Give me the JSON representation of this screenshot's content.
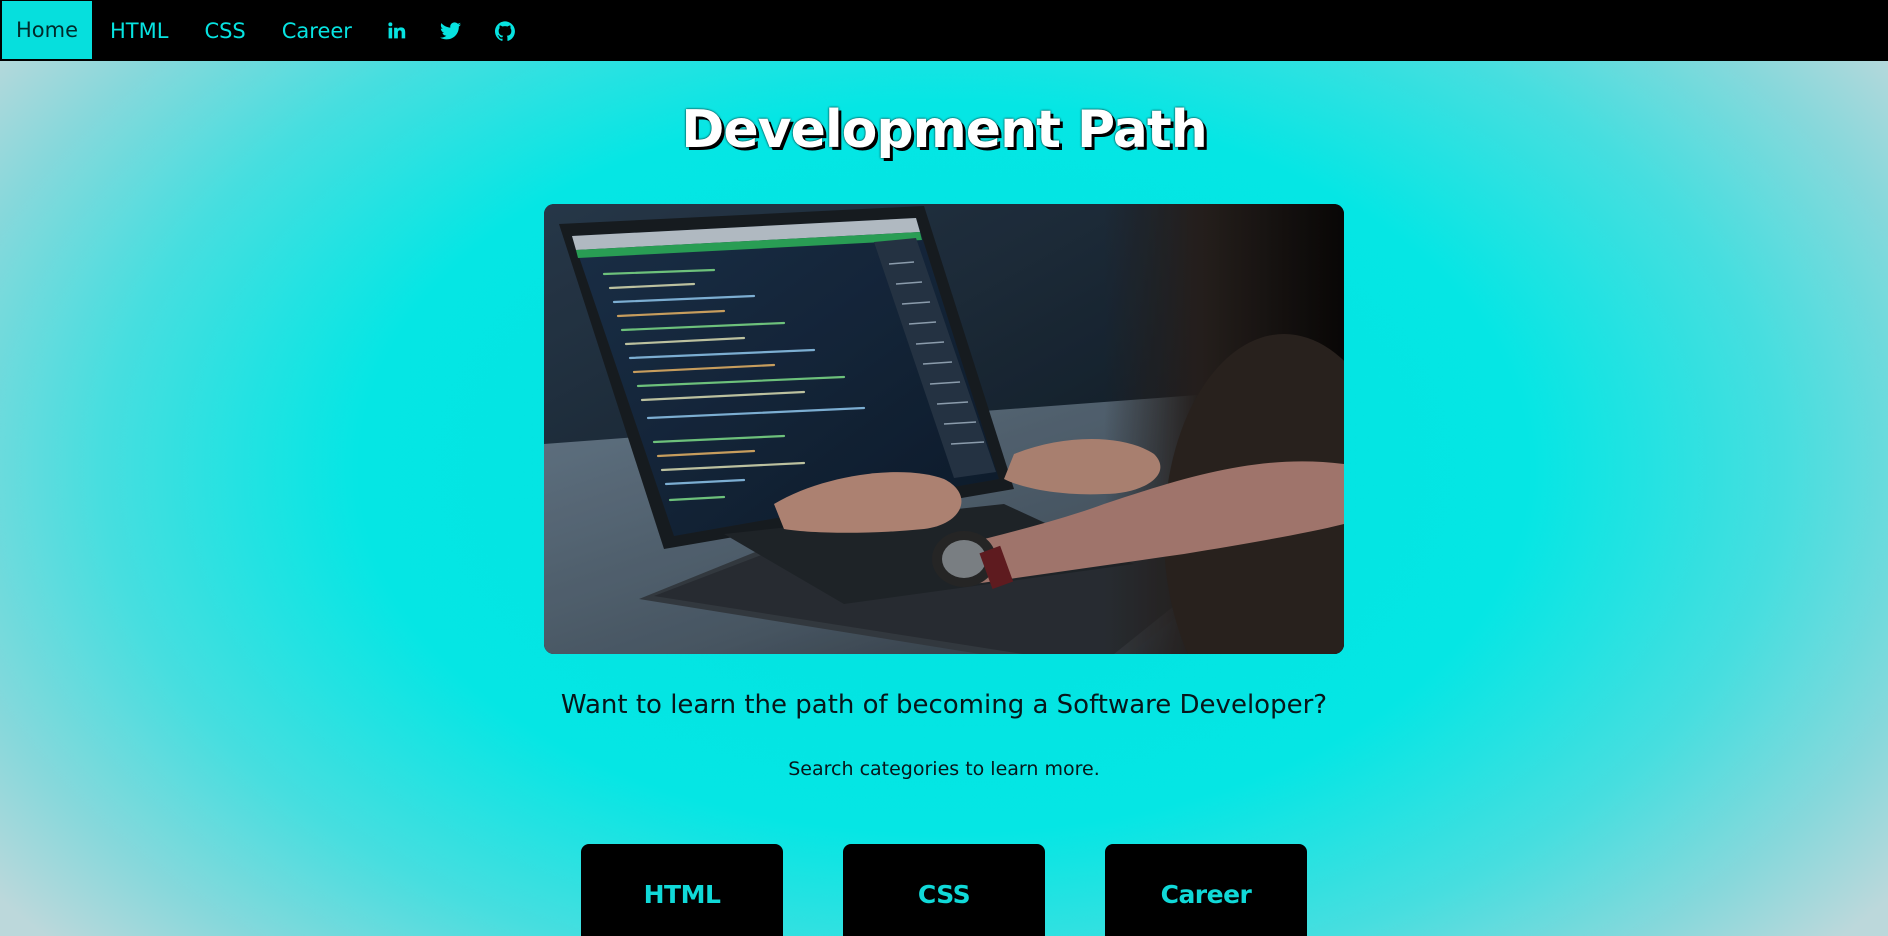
{
  "nav": {
    "items": [
      {
        "label": "Home",
        "active": true
      },
      {
        "label": "HTML",
        "active": false
      },
      {
        "label": "CSS",
        "active": false
      },
      {
        "label": "Career",
        "active": false
      }
    ],
    "icons": [
      "linkedin-icon",
      "twitter-icon",
      "github-icon"
    ]
  },
  "hero": {
    "title": "Development Path",
    "image_alt": "laptop-coding-photo",
    "question": "Want to learn the path of becoming a Software Developer?",
    "subtext": "Search categories to learn more."
  },
  "categories": [
    {
      "label": "HTML"
    },
    {
      "label": "CSS"
    },
    {
      "label": "Career"
    }
  ],
  "colors": {
    "accent": "#07e3e1",
    "nav_bg": "#000000",
    "card_bg": "#000000",
    "card_text": "#10d9d8",
    "title_text": "#ffffff"
  }
}
